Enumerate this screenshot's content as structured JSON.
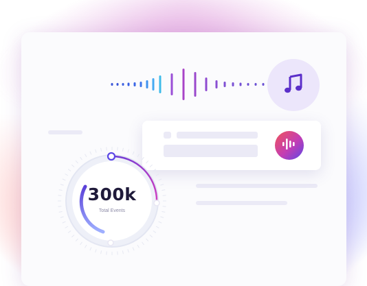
{
  "stats": {
    "total_events_value": "300k",
    "total_events_label": "Total Events"
  },
  "icons": {
    "music": "music-note-icon",
    "audio": "audio-wave-icon"
  },
  "colors": {
    "accent_purple": "#6a3cd6",
    "gradient_red": "#f0545a",
    "gradient_magenta": "#c33db4",
    "gradient_blue": "#5b46e6",
    "card_background": "#fbfbfd",
    "placeholder": "#ebeaf6"
  }
}
